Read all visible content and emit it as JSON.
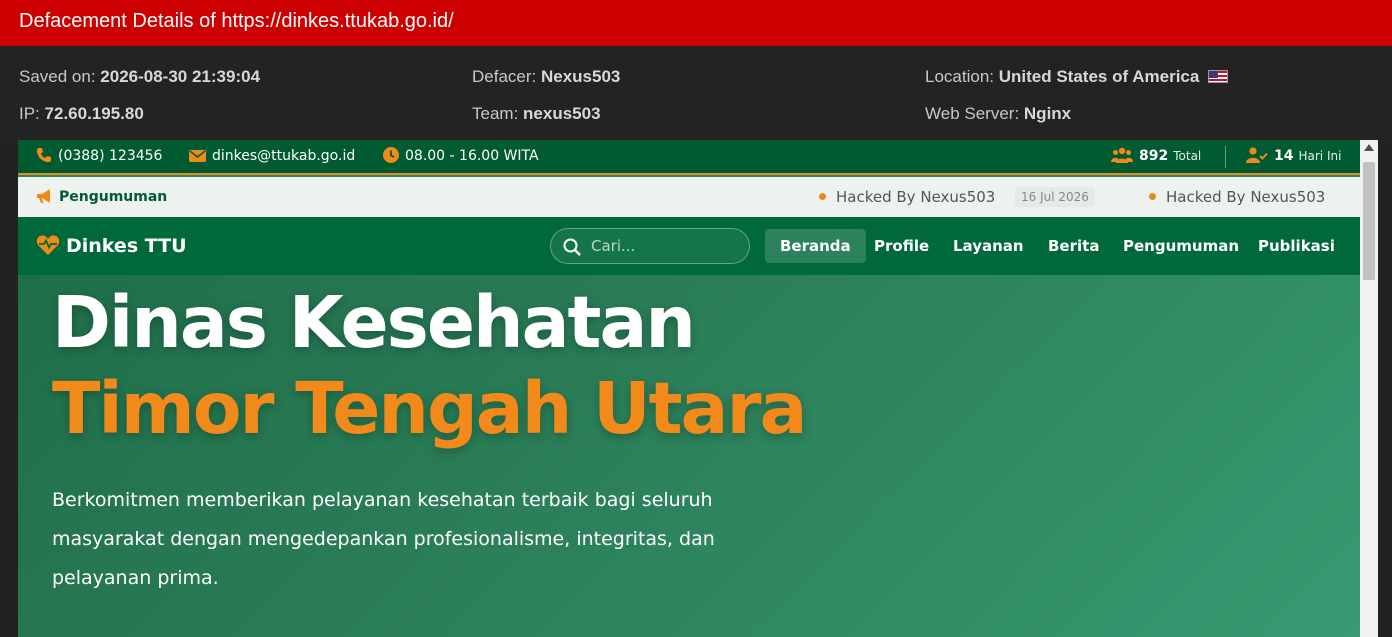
{
  "window": {
    "title": "Defacement Details of https://dinkes.ttukab.go.id/"
  },
  "meta": {
    "saved_label": "Saved on:",
    "saved_value": "2026-08-30 21:39:04",
    "defacer_label": "Defacer:",
    "defacer_value": "Nexus503",
    "location_label": "Location:",
    "location_value": "United States of America",
    "ip_label": "IP:",
    "ip_value": "72.60.195.80",
    "team_label": "Team:",
    "team_value": "nexus503",
    "server_label": "Web Server:",
    "server_value": "Nginx"
  },
  "site": {
    "topbar": {
      "phone": "(0388) 123456",
      "email": "dinkes@ttukab.go.id",
      "hours": "08.00 - 16.00 WITA",
      "total_count": "892",
      "total_label": "Total",
      "today_count": "14",
      "today_label": "Hari Ini"
    },
    "announce": {
      "label": "Pengumuman",
      "items": [
        {
          "text": "Hacked By Nexus503",
          "date": "16 Jul 2026"
        },
        {
          "text": "Hacked By Nexus503"
        }
      ]
    },
    "navbar": {
      "brand": "Dinkes TTU",
      "search_placeholder": "Cari...",
      "items": [
        "Beranda",
        "Profile",
        "Layanan",
        "Berita",
        "Pengumuman",
        "Publikasi"
      ],
      "active": "Beranda"
    },
    "hero": {
      "title_line1": "Dinas Kesehatan",
      "title_line2": "Timor Tengah Utara",
      "description": "Berkomitmen memberikan pelayanan kesehatan terbaik bagi seluruh masyarakat dengan mengedepankan profesionalisme, integritas, dan pelayanan prima."
    }
  },
  "colors": {
    "titlebar": "#cc0000",
    "site_green": "#00693b",
    "accent_orange": "#e8891d"
  }
}
